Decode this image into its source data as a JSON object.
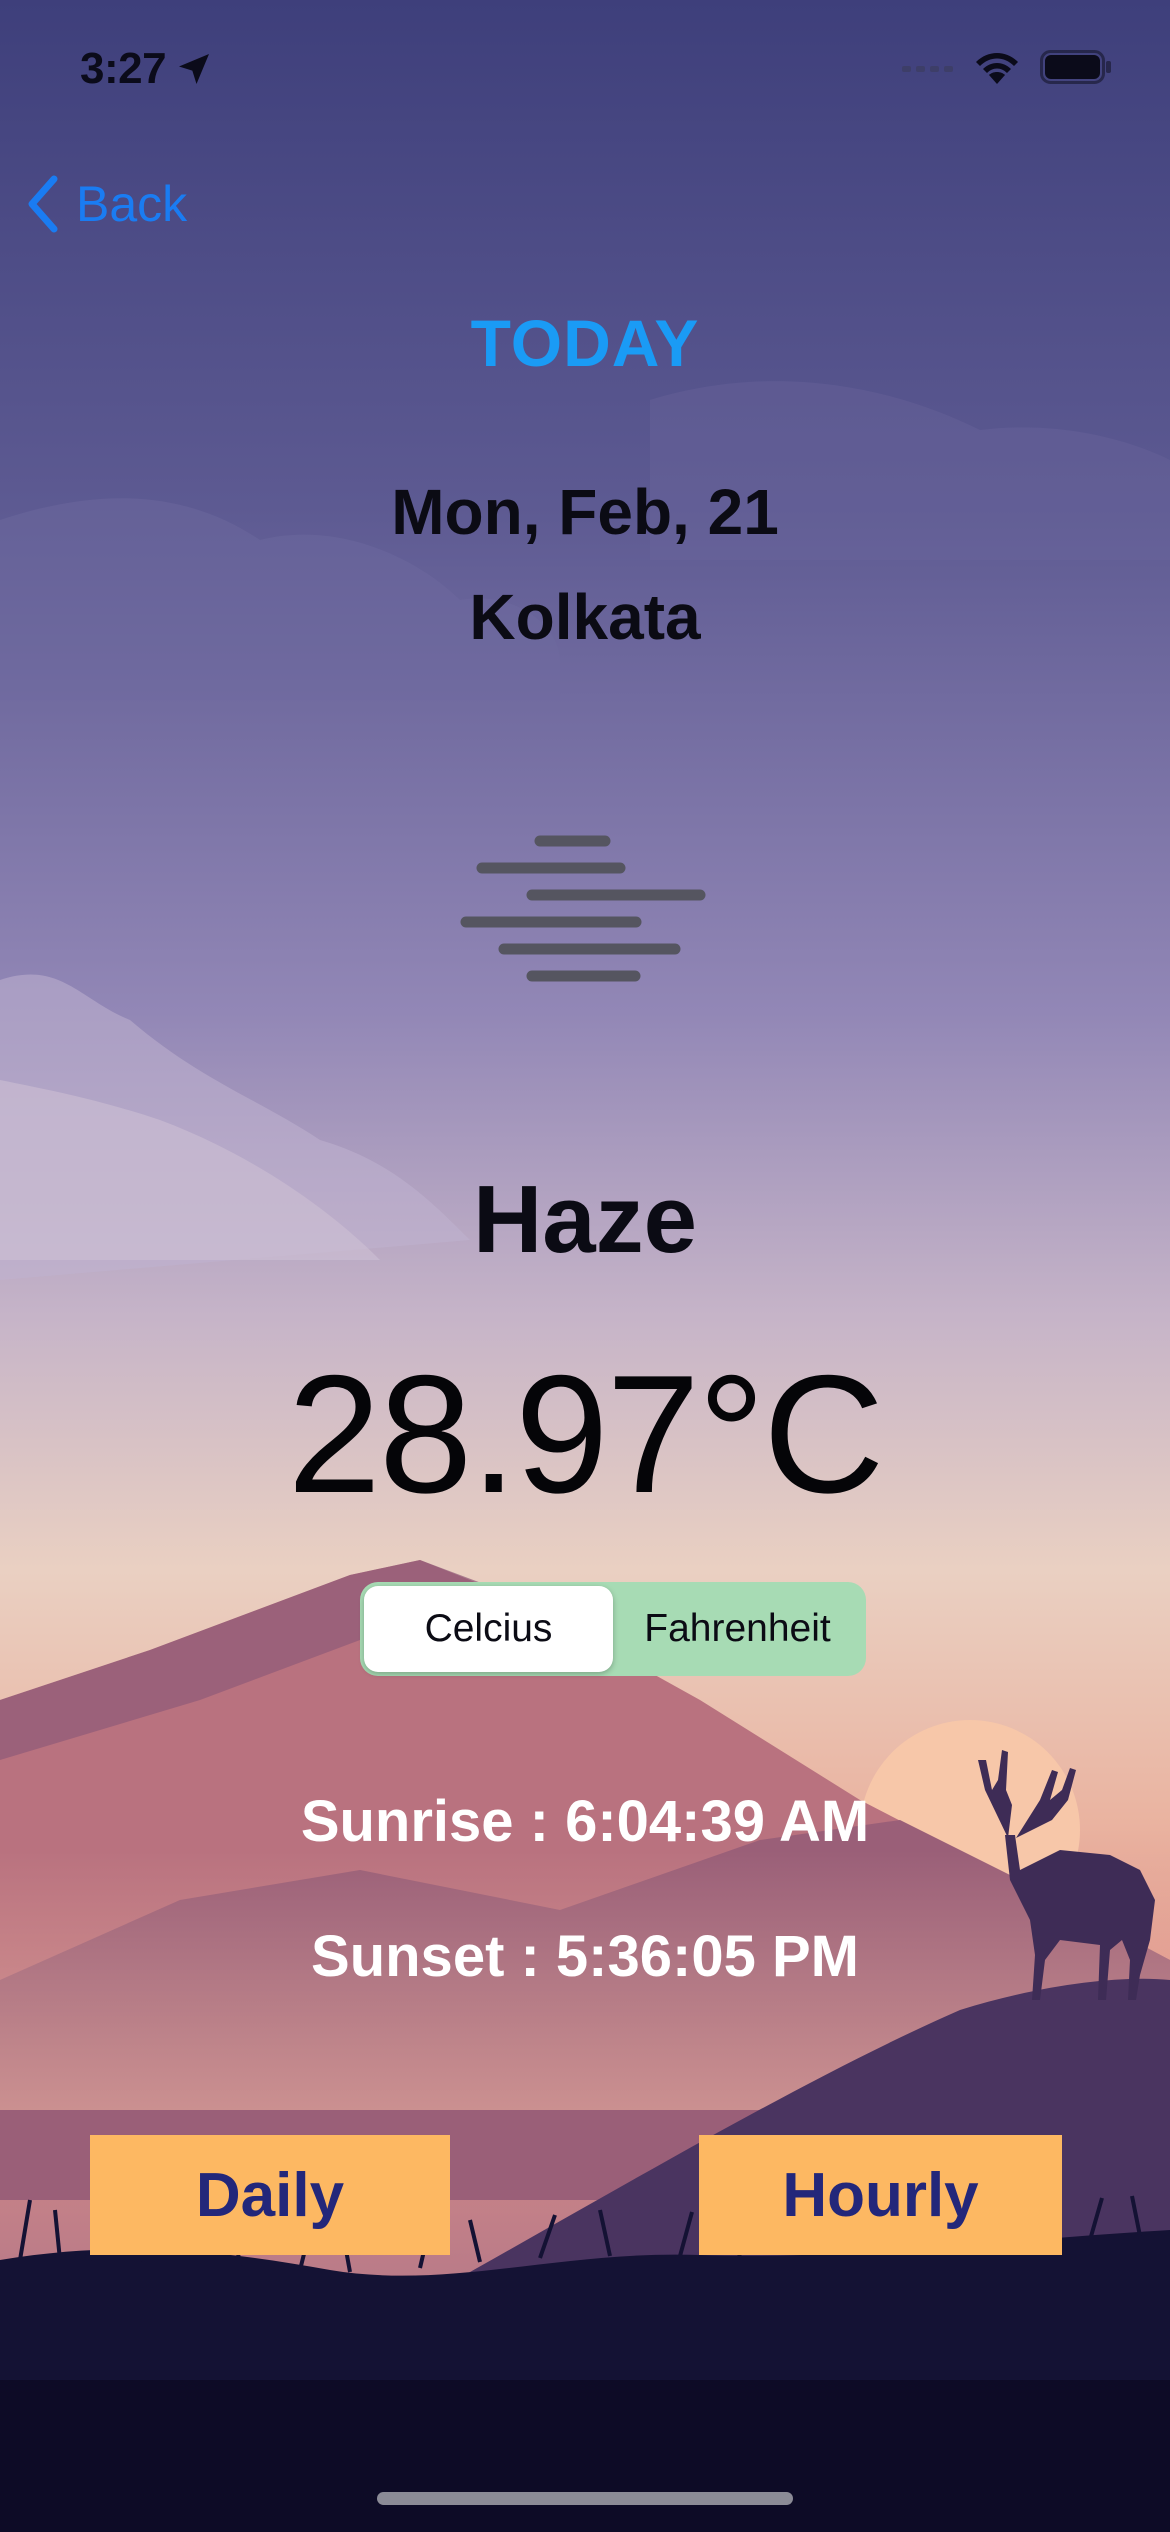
{
  "status_bar": {
    "time": "3:27"
  },
  "nav": {
    "back_label": "Back"
  },
  "header": {
    "title": "TODAY"
  },
  "weather": {
    "date": "Mon, Feb, 21",
    "city": "Kolkata",
    "condition": "Haze",
    "temperature": "28.97°C"
  },
  "units": {
    "options": [
      "Celcius",
      "Fahrenheit"
    ],
    "selected": "Celcius"
  },
  "sun": {
    "sunrise": "Sunrise : 6:04:39 AM",
    "sunset": "Sunset : 5:36:05 PM"
  },
  "actions": {
    "daily_label": "Daily",
    "hourly_label": "Hourly"
  },
  "colors": {
    "title_accent": "#1a9bf5",
    "back_link": "#1a7cf2",
    "segment_bg": "#a7dbb4",
    "button_bg": "#fdb862",
    "button_text": "#23277a"
  },
  "icons": [
    "location-arrow-icon",
    "cellular-signal-icon",
    "wifi-icon",
    "battery-icon",
    "chevron-left-icon",
    "haze-icon"
  ]
}
